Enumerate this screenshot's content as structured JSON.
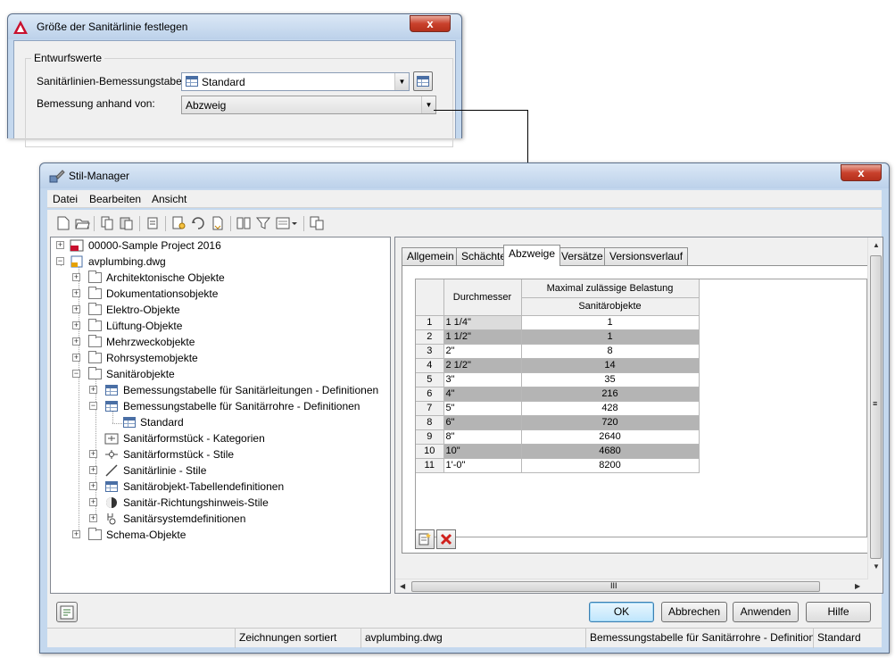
{
  "dialog1": {
    "title": "Größe der Sanitärlinie festlegen",
    "close_label": "x",
    "group_title": "Entwurfswerte",
    "table_label": "Sanitärlinien-Bemessungstabelle:",
    "table_value": "Standard",
    "basis_label": "Bemessung anhand von:",
    "basis_value": "Abzweig"
  },
  "manager": {
    "title": "Stil-Manager",
    "close_label": "x",
    "menu": [
      "Datei",
      "Bearbeiten",
      "Ansicht"
    ],
    "toolbar_icons": [
      "new-drawing-icon",
      "open-drawing-icon",
      "copy-icon",
      "paste-icon",
      "purge-icon",
      "new-style-icon",
      "edit-style-icon",
      "sort-icon",
      "toggle-view-icon",
      "filter-icon",
      "view-dropdown-icon",
      "synchronize-icon"
    ],
    "tree": [
      {
        "label": "00000-Sample Project 2016"
      },
      {
        "label": "avplumbing.dwg"
      },
      {
        "label": "Architektonische Objekte"
      },
      {
        "label": "Dokumentationsobjekte"
      },
      {
        "label": "Elektro-Objekte"
      },
      {
        "label": "Lüftung-Objekte"
      },
      {
        "label": "Mehrzweckobjekte"
      },
      {
        "label": "Rohrsystemobjekte"
      },
      {
        "label": "Sanitärobjekte"
      },
      {
        "label": "Bemessungstabelle für Sanitärleitungen - Definitionen"
      },
      {
        "label": "Bemessungstabelle für Sanitärrohre - Definitionen"
      },
      {
        "label": "Standard"
      },
      {
        "label": "Sanitärformstück - Kategorien"
      },
      {
        "label": "Sanitärformstück - Stile"
      },
      {
        "label": "Sanitärlinie - Stile"
      },
      {
        "label": "Sanitärobjekt-Tabellendefinitionen"
      },
      {
        "label": "Sanitär-Richtungshinweis-Stile"
      },
      {
        "label": "Sanitärsystemdefinitionen"
      },
      {
        "label": "Schema-Objekte"
      }
    ],
    "tabs": [
      "Allgemein",
      "Schächte",
      "Abzweige",
      "Versätze",
      "Versionsverlauf"
    ],
    "active_tab": "Abzweige",
    "grid": {
      "header_size": "Durchmesser",
      "header_group": "Maximal zulässige Belastung",
      "header_sub": "Sanitärobjekte",
      "rows": [
        {
          "num": "1",
          "size": "1 1/4\"",
          "value": "1"
        },
        {
          "num": "2",
          "size": "1 1/2\"",
          "value": "1"
        },
        {
          "num": "3",
          "size": "2\"",
          "value": "8"
        },
        {
          "num": "4",
          "size": "2 1/2\"",
          "value": "14"
        },
        {
          "num": "5",
          "size": "3\"",
          "value": "35"
        },
        {
          "num": "6",
          "size": "4\"",
          "value": "216"
        },
        {
          "num": "7",
          "size": "5\"",
          "value": "428"
        },
        {
          "num": "8",
          "size": "6\"",
          "value": "720"
        },
        {
          "num": "9",
          "size": "8\"",
          "value": "2640"
        },
        {
          "num": "10",
          "size": "10\"",
          "value": "4680"
        },
        {
          "num": "11",
          "size": "1'-0\"",
          "value": "8200"
        }
      ]
    },
    "hscroll_label": "III",
    "vscroll_label": "≡",
    "buttons": {
      "ok": "OK",
      "cancel": "Abbrechen",
      "apply": "Anwenden",
      "help": "Hilfe"
    },
    "status": [
      "Zeichnungen sortiert",
      "avplumbing.dwg",
      "Bemessungstabelle für Sanitärrohre - Definition",
      "Standard"
    ]
  }
}
